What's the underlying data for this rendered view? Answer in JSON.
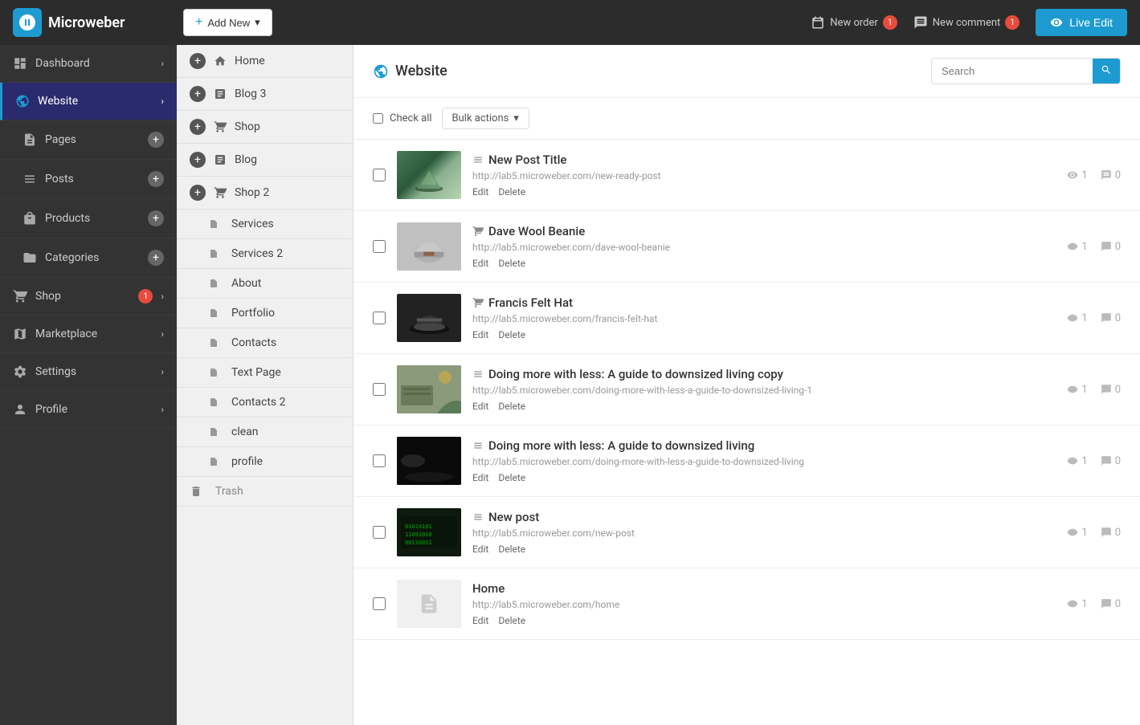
{
  "topnav": {
    "logo_text": "Microweber",
    "add_new_label": "Add New",
    "new_order_label": "New order",
    "new_order_badge": "1",
    "new_comment_label": "New comment",
    "new_comment_badge": "1",
    "live_edit_label": "Live Edit"
  },
  "sidebar": {
    "items": [
      {
        "id": "dashboard",
        "label": "Dashboard",
        "icon": "dashboard-icon",
        "chevron": true
      },
      {
        "id": "website",
        "label": "Website",
        "icon": "globe-icon",
        "active": true,
        "chevron": true
      },
      {
        "id": "pages",
        "label": "Pages",
        "icon": "pages-icon",
        "add": true
      },
      {
        "id": "posts",
        "label": "Posts",
        "icon": "posts-icon",
        "add": true
      },
      {
        "id": "products",
        "label": "Products",
        "icon": "products-icon",
        "add": true
      },
      {
        "id": "categories",
        "label": "Categories",
        "icon": "categories-icon",
        "add": true
      },
      {
        "id": "shop",
        "label": "Shop",
        "icon": "shop-icon",
        "badge": "1",
        "chevron": true
      },
      {
        "id": "marketplace",
        "label": "Marketplace",
        "icon": "marketplace-icon",
        "chevron": true
      },
      {
        "id": "settings",
        "label": "Settings",
        "icon": "settings-icon",
        "chevron": true
      },
      {
        "id": "profile",
        "label": "Profile",
        "icon": "profile-icon",
        "chevron": true
      }
    ]
  },
  "midsidebar": {
    "items": [
      {
        "id": "home",
        "label": "Home",
        "type": "page",
        "has_add": true
      },
      {
        "id": "blog3",
        "label": "Blog 3",
        "type": "blog",
        "has_add": true
      },
      {
        "id": "shop",
        "label": "Shop",
        "type": "shop",
        "has_add": true
      },
      {
        "id": "blog",
        "label": "Blog",
        "type": "blog",
        "has_add": true
      },
      {
        "id": "shop2",
        "label": "Shop 2",
        "type": "shop",
        "has_add": true
      },
      {
        "id": "services",
        "label": "Services",
        "type": "sub",
        "indent": true
      },
      {
        "id": "services2",
        "label": "Services 2",
        "type": "sub",
        "indent": true
      },
      {
        "id": "about",
        "label": "About",
        "type": "sub",
        "indent": true
      },
      {
        "id": "portfolio",
        "label": "Portfolio",
        "type": "sub",
        "indent": true
      },
      {
        "id": "contacts",
        "label": "Contacts",
        "type": "sub",
        "indent": true
      },
      {
        "id": "textpage",
        "label": "Text Page",
        "type": "sub",
        "indent": true
      },
      {
        "id": "contacts2",
        "label": "Contacts 2",
        "type": "sub",
        "indent": true
      },
      {
        "id": "clean",
        "label": "clean",
        "type": "sub",
        "indent": true
      },
      {
        "id": "profile",
        "label": "profile",
        "type": "sub",
        "indent": true
      },
      {
        "id": "trash",
        "label": "Trash",
        "type": "trash"
      }
    ]
  },
  "main": {
    "title": "Website",
    "search_placeholder": "Search",
    "bulk_actions_label": "Bulk actions",
    "check_all_label": "Check all",
    "posts": [
      {
        "id": 1,
        "title": "New Post Title",
        "icon": "lines",
        "url": "http://lab5.microweber.com/new-ready-post",
        "views": "1",
        "comments": "0",
        "thumb_color": "#5a8a6a",
        "thumb_type": "mountain"
      },
      {
        "id": 2,
        "title": "Dave Wool Beanie",
        "icon": "shop",
        "url": "http://lab5.microweber.com/dave-wool-beanie",
        "views": "1",
        "comments": "0",
        "thumb_color": "#b0b0b0",
        "thumb_type": "hat"
      },
      {
        "id": 3,
        "title": "Francis Felt Hat",
        "icon": "shop",
        "url": "http://lab5.microweber.com/francis-felt-hat",
        "views": "1",
        "comments": "0",
        "thumb_color": "#333",
        "thumb_type": "hat2"
      },
      {
        "id": 4,
        "title": "Doing more with less: A guide to downsized living copy",
        "icon": "lines",
        "url": "http://lab5.microweber.com/doing-more-with-less-a-guide-to-downsized-living-1",
        "views": "1",
        "comments": "0",
        "thumb_color": "#8a9a7a",
        "thumb_type": "desk"
      },
      {
        "id": 5,
        "title": "Doing more with less: A guide to downsized living",
        "icon": "lines",
        "url": "http://lab5.microweber.com/doing-more-with-less-a-guide-to-downsized-living",
        "views": "1",
        "comments": "0",
        "thumb_color": "#111",
        "thumb_type": "dark"
      },
      {
        "id": 6,
        "title": "New post",
        "icon": "lines",
        "url": "http://lab5.microweber.com/new-post",
        "views": "1",
        "comments": "0",
        "thumb_color": "#1a3a1a",
        "thumb_type": "code"
      },
      {
        "id": 7,
        "title": "Home",
        "icon": "none",
        "url": "http://lab5.microweber.com/home",
        "views": "1",
        "comments": "0",
        "thumb_color": "#f0f0f0",
        "thumb_type": "home"
      }
    ]
  }
}
